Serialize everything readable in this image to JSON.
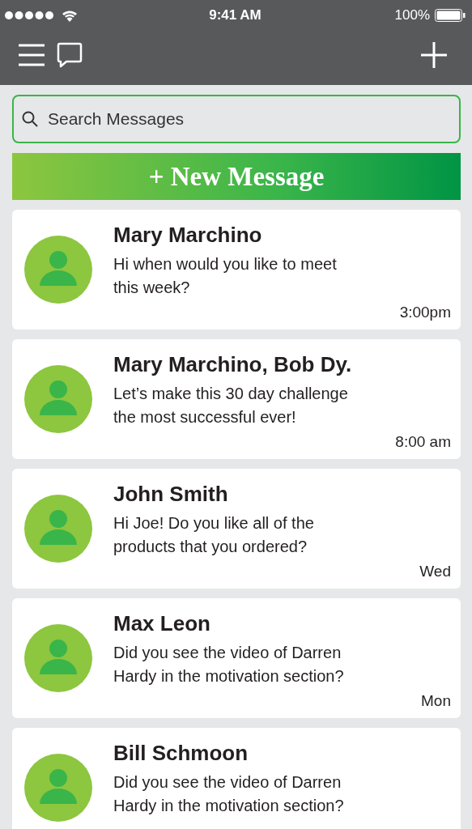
{
  "status_bar": {
    "time": "9:41 AM",
    "battery": "100%"
  },
  "search": {
    "placeholder": "Search Messages"
  },
  "new_message_button": "+ New Message",
  "conversations": [
    {
      "name": "Mary Marchino",
      "message": "Hi when would you like to meet this week?",
      "time": "3:00pm"
    },
    {
      "name": "Mary Marchino, Bob Dy.",
      "message": "Let’s make this 30 day challenge the most successful ever!",
      "time": "8:00 am"
    },
    {
      "name": "John Smith",
      "message": "Hi Joe! Do you like all of the products that you ordered?",
      "time": "Wed"
    },
    {
      "name": "Max Leon",
      "message": "Did you see the video of Darren Hardy in the motivation section?",
      "time": "Mon"
    },
    {
      "name": "Bill Schmoon",
      "message": "Did you see the video of Darren Hardy in the motivation section?"
    }
  ]
}
